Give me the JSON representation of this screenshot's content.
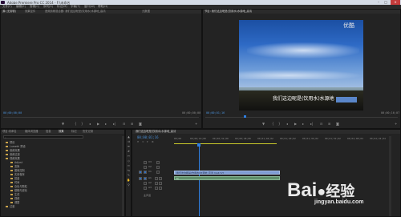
{
  "window": {
    "title": "Adobe Premiere Pro CC 2014 - F:\\未命名",
    "minimize": "–",
    "maximize": "□",
    "close": "×"
  },
  "menu": [
    "文件(F)",
    "编辑(E)",
    "剪辑(C)",
    "序列(S)",
    "标记(M)",
    "字幕(T)",
    "窗口(W)",
    "帮助(H)"
  ],
  "source_panel": {
    "tabs": [
      "源:(无剪辑)",
      "效果控件",
      "音频剪辑混合器: 我们这边呢是(饮用水)水源地_高清",
      "元数据"
    ],
    "timecode_left": "00;00;00;00",
    "timecode_right": "00;00;00;00"
  },
  "program_panel": {
    "tab": "节目: 我们这边呢是(饮用水)水源地_高清",
    "logo": "优酷",
    "subtitle": "我们这边呢是(饮用水)水源地",
    "timecode_left": "00;00;01;16",
    "timecode_right": "00;00;16;07"
  },
  "project_panel": {
    "tabs": [
      "项目:未命名",
      "媒体浏览器",
      "信息",
      "效果",
      "标记",
      "历史记录"
    ],
    "search_placeholder": "",
    "items": [
      "预设",
      "Lumetri 预设",
      "音频效果",
      "音频过渡",
      "视频效果",
      "Adjust",
      "变换",
      "图像控制",
      "实用程序",
      "扭曲",
      "时间",
      "杂色与颗粒",
      "模糊与锐化",
      "生成",
      "视频",
      "调整",
      "过渡"
    ]
  },
  "timeline": {
    "tab": "我们这边呢是(饮用水)水源地_高清",
    "timecode": "00;00;01;16",
    "ruler": [
      "00;00",
      "00;00;16;00",
      "00;00;32;00",
      "00;00;48;00",
      "00;01;04;02",
      "00;01;20;02",
      "00;01;36;02",
      "00;01;52;02",
      "00;02;08;04",
      "00;02;24;04"
    ],
    "tracks": [
      {
        "id": "V3"
      },
      {
        "id": "V2"
      },
      {
        "id": "V1"
      },
      {
        "id": "A1"
      },
      {
        "id": "A2"
      },
      {
        "id": "A3"
      }
    ],
    "video_clip": "我们这边呢是(饮用水)水源地_高清 mp4 [V]",
    "master_label": "主声道"
  },
  "watermark": {
    "brand": "Bai",
    "brand_suffix": "经验",
    "url": "jingyan.baidu.com"
  },
  "colors": {
    "accent_blue": "#4a8fd6",
    "playhead": "#2f7ee0",
    "clip_video": "#7e9bd2",
    "clip_audio": "#5f8e6a",
    "folder": "#c9a24a"
  }
}
